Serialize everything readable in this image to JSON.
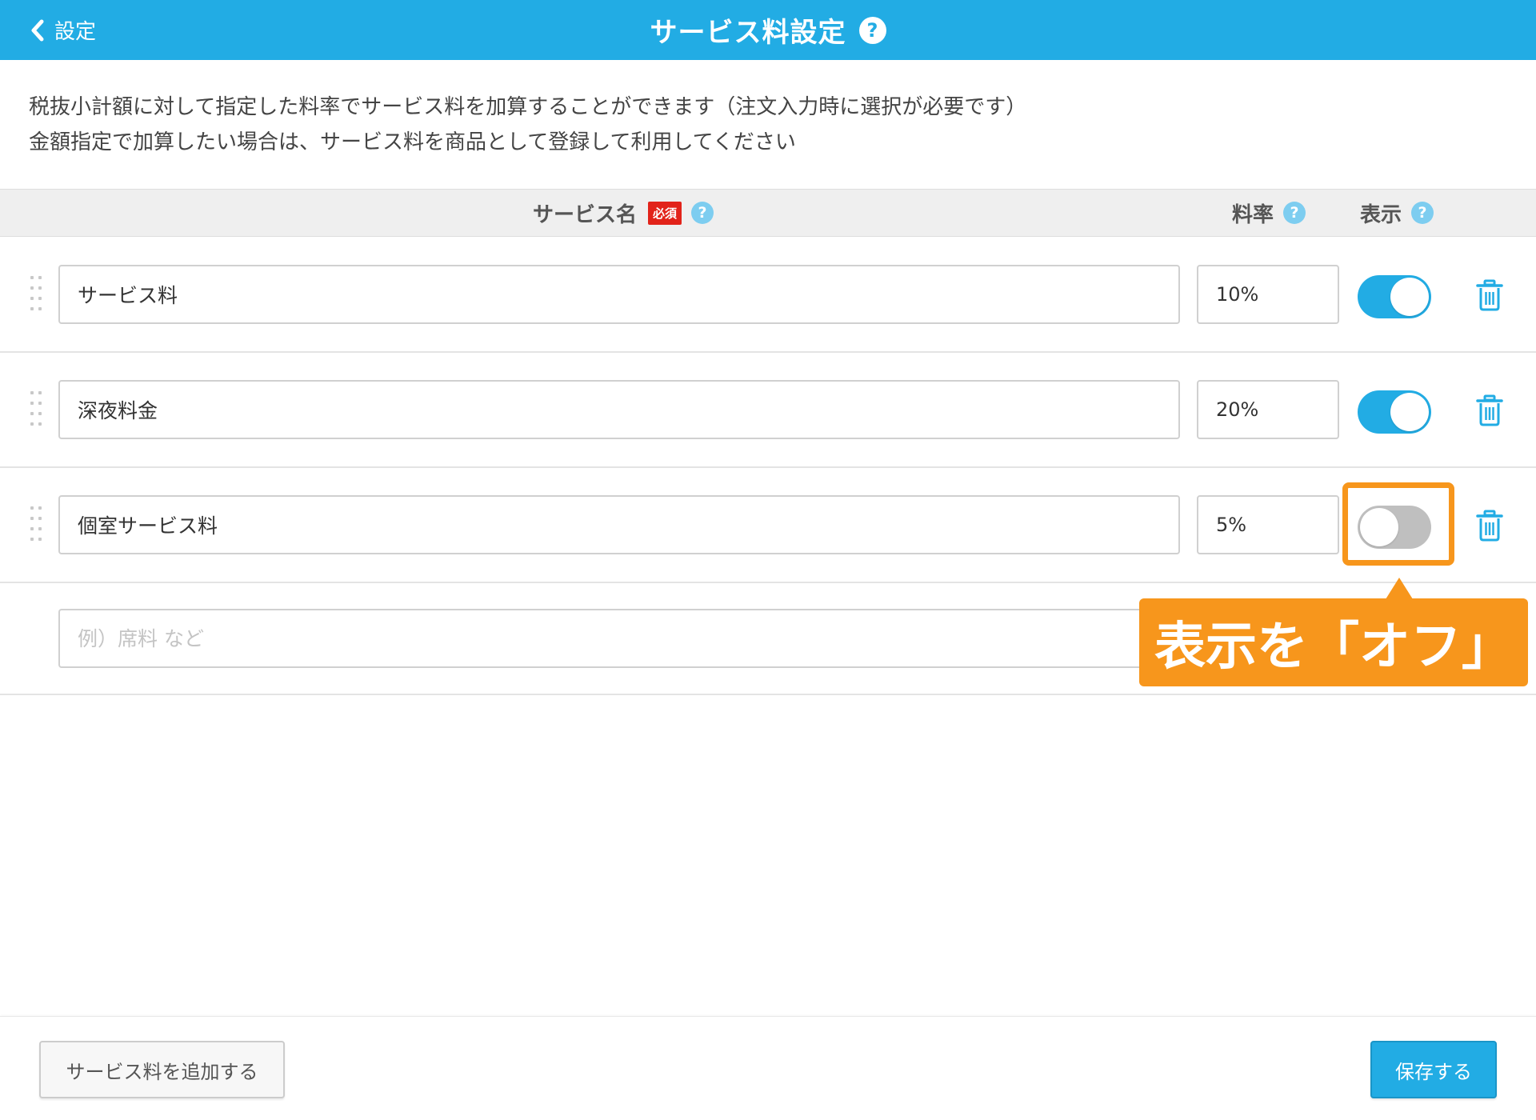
{
  "header": {
    "back_label": "設定",
    "title": "サービス料設定",
    "help_glyph": "?"
  },
  "description": {
    "line1": "税抜小計額に対して指定した料率でサービス料を加算することができます（注文入力時に選択が必要です）",
    "line2": "金額指定で加算したい場合は、サービス料を商品として登録して利用してください"
  },
  "table_header": {
    "name": "サービス名",
    "required_badge": "必須",
    "rate": "料率",
    "show": "表示",
    "help_glyph": "?"
  },
  "rows": [
    {
      "name": "サービス料",
      "rate": "10%",
      "visible": true
    },
    {
      "name": "深夜料金",
      "rate": "20%",
      "visible": true
    },
    {
      "name": "個室サービス料",
      "rate": "5%",
      "visible": false
    }
  ],
  "new_row": {
    "name_placeholder": "例）席料 など"
  },
  "callout": {
    "text": "表示を「オフ」"
  },
  "footer": {
    "add_label": "サービス料を追加する",
    "save_label": "保存する"
  },
  "colors": {
    "accent": "#22ace4",
    "highlight": "#f7961c",
    "required": "#e2231a"
  }
}
